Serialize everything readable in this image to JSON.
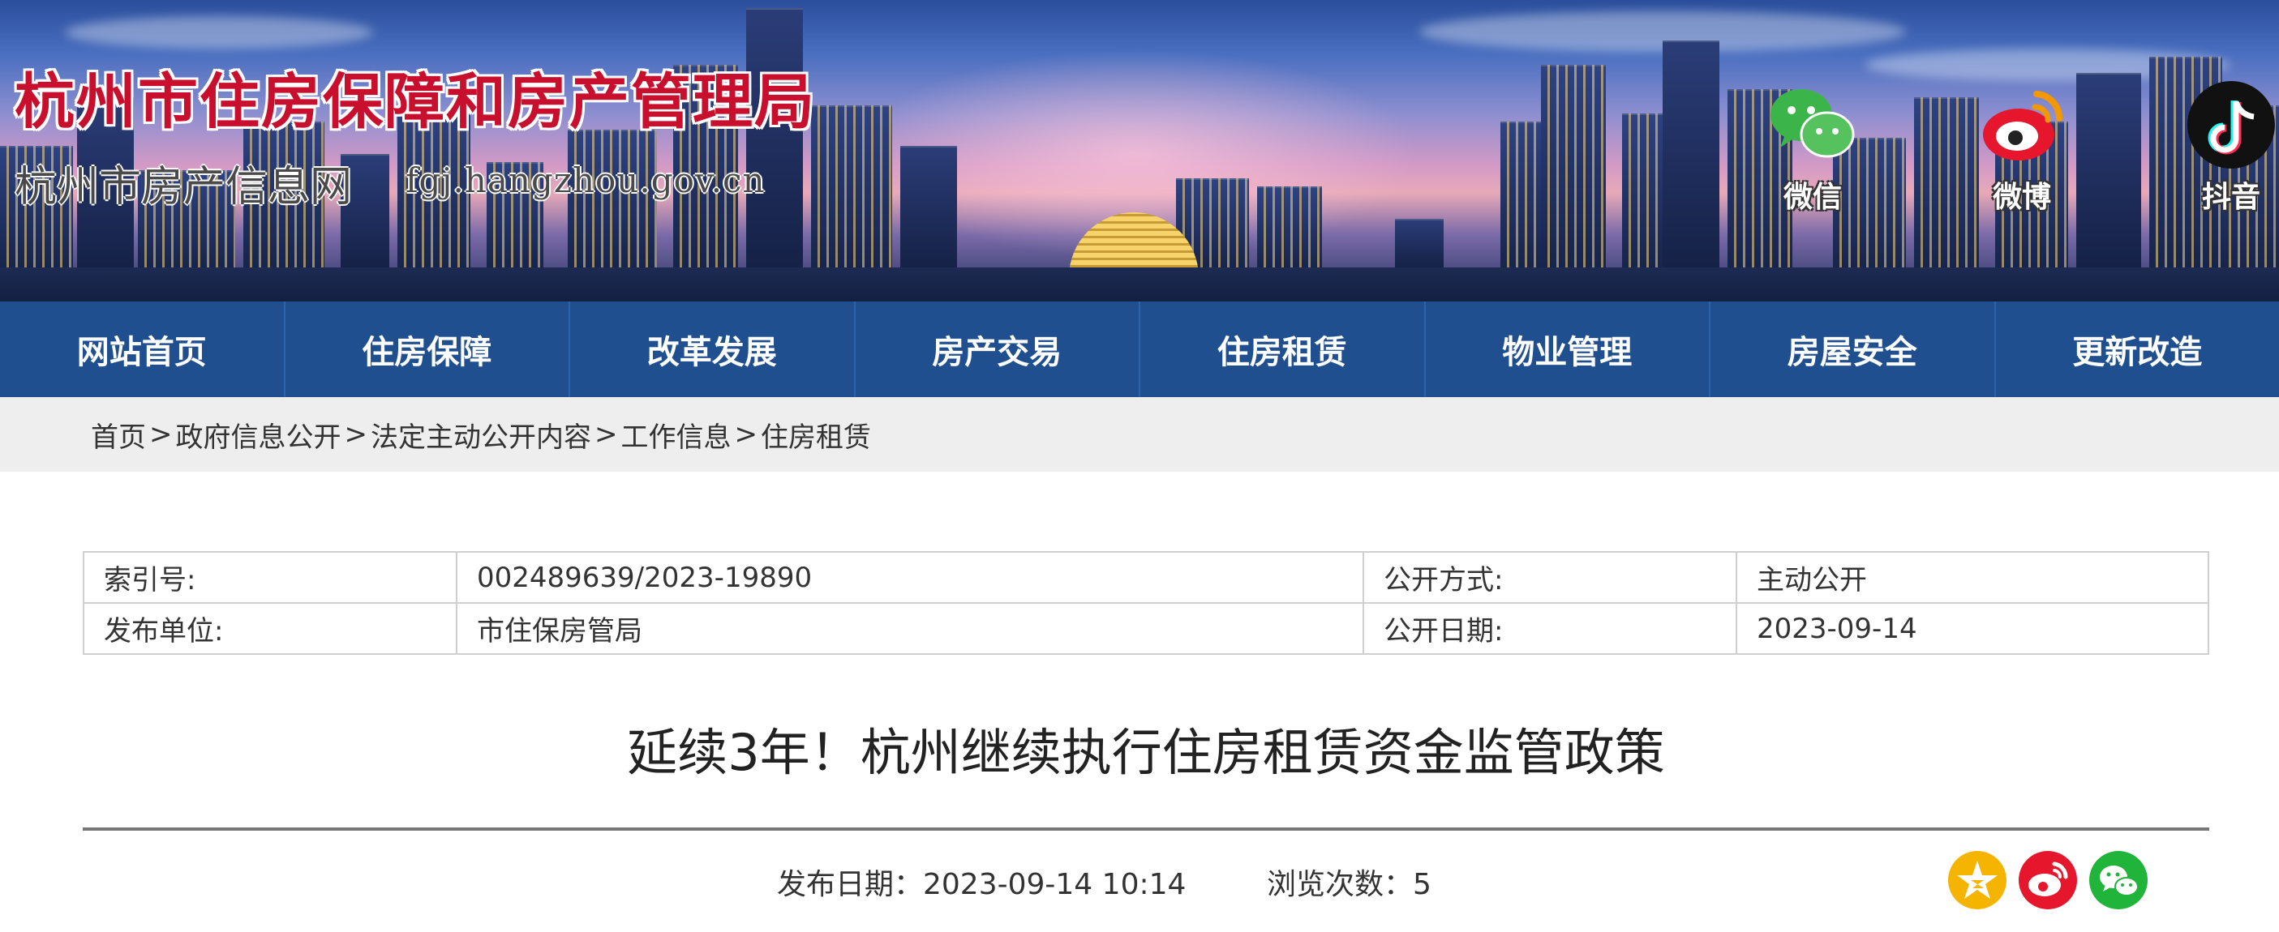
{
  "header": {
    "site_title": "杭州市住房保障和房产管理局",
    "site_subtitle": "杭州市房产信息网",
    "site_domain": "fgj.hangzhou.gov.cn",
    "social": [
      {
        "label": "微信",
        "icon": "wechat-icon"
      },
      {
        "label": "微博",
        "icon": "weibo-icon"
      },
      {
        "label": "抖音",
        "icon": "douyin-icon"
      }
    ]
  },
  "nav": {
    "items": [
      "网站首页",
      "住房保障",
      "改革发展",
      "房产交易",
      "住房租赁",
      "物业管理",
      "房屋安全",
      "更新改造"
    ]
  },
  "breadcrumb": {
    "items": [
      "首页",
      "政府信息公开",
      "法定主动公开内容",
      "工作信息",
      "住房租赁"
    ],
    "separator": ">"
  },
  "info": {
    "index_label": "索引号:",
    "index_value": "002489639/2023-19890",
    "method_label": "公开方式:",
    "method_value": "主动公开",
    "publisher_label": "发布单位:",
    "publisher_value": "市住保房管局",
    "date_label": "公开日期:",
    "date_value": "2023-09-14"
  },
  "article": {
    "title": "延续3年！杭州继续执行住房租赁资金监管政策",
    "publish_label": "发布日期：2023-09-14 10:14",
    "views_label": "浏览次数：5"
  },
  "share": {
    "icons": [
      "qzone-icon",
      "weibo-icon",
      "wechat-icon"
    ],
    "colors": [
      "#f5b400",
      "#e6162d",
      "#21b43a"
    ]
  },
  "colors": {
    "nav_bg": "#1f4f8f",
    "title_red": "#c8102e",
    "breadcrumb_bg": "#eeeeee"
  }
}
